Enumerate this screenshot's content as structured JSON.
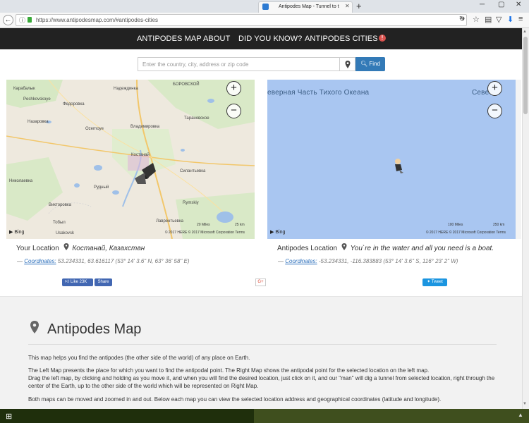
{
  "browser": {
    "tab_title": "Antipodes Map - Tunnel to t",
    "url": "https://www.antipodesmap.com/#antipodes-cities"
  },
  "site_nav": {
    "items": [
      "ANTIPODES MAP",
      "ABOUT",
      "DID YOU KNOW?",
      "ANTIPODES CITIES"
    ]
  },
  "search": {
    "placeholder": "Enter the country, city, address or zip code",
    "button_label": "Find"
  },
  "left_map": {
    "labels": [
      "Карабалык",
      "Надеждинка",
      "БОРОВСКОЙ",
      "Peshkovskoye",
      "Федоровка",
      "Тарановское",
      "Назаровка",
      "Ozernoye",
      "Владимировка",
      "Костанай",
      "Силантьевка",
      "Николаевка",
      "Рудный",
      "Викторовка",
      "Rymskiy",
      "Тобыл",
      "Лаврентьевка",
      "Usakovsk"
    ],
    "scale_1": "20 Miles",
    "scale_2": "25 km",
    "copyright": "© 2017 HERE © 2017 Microsoft Corporation Terms",
    "bing": "Bing"
  },
  "right_map": {
    "ocean_label_1": "еверная Часть Тихого Океана",
    "ocean_label_2": "Севе",
    "scale_1": "100 Miles",
    "scale_2": "250 km",
    "copyright": "© 2017 HERE © 2017 Microsoft Corporation Terms",
    "bing": "Bing"
  },
  "left_panel": {
    "title": "Your Location",
    "place": "Костанай, Казахстан",
    "coord_label": "Coordinates:",
    "coords": "53.234331, 63.616117 (53° 14' 3.6\" N, 63° 36' 58\" E)"
  },
  "right_panel": {
    "title": "Antipodes Location",
    "place": "You`re in the water and all you need is a boat.",
    "coord_label": "Coordinates:",
    "coords": "-53.234331, -116.383883 (53° 14' 3.6\" S, 116° 23' 2\" W)"
  },
  "social": {
    "fb_like": "Like 23K",
    "fb_share": "Share",
    "gplus": "G+",
    "tweet": "Tweet"
  },
  "about": {
    "title": "Antipodes Map",
    "p1": "This map helps you find the antipodes (the other side of the world) of any place on Earth.",
    "p2": "The Left Map presents the place for which you want to find the antipodal point. The Right Map shows the antipodal point for the selected location on the left map.",
    "p3": "Drag the left map, by clicking and holding as you move it, and when you will find the desired location, just click on it, and our \"man\" will dig a tunnel from selected location, right through the center of the Earth, up to the other side of the world which will be represented on Right Map.",
    "p4": "Both maps can be moved and zoomed in and out. Below each map you can view the selected location address and geographical coordinates (latitude and longitude)."
  }
}
